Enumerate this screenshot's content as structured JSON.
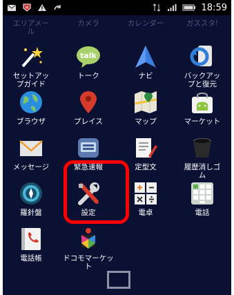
{
  "status_bar": {
    "time": "18:59",
    "left_icons": [
      "mail-icon",
      "shield-m-icon",
      "warning-icon",
      "sync-icon"
    ],
    "right_icons": [
      "data-arrows-icon",
      "signal-icon",
      "battery-icon"
    ]
  },
  "top_row": [
    {
      "label": "エリアメー\nル"
    },
    {
      "label": "カメラ"
    },
    {
      "label": "カレンダー"
    },
    {
      "label": "ガススタ!"
    }
  ],
  "apps": [
    {
      "label": "セットアッ\nプガイド",
      "icon": "setup-wand-icon"
    },
    {
      "label": "トーク",
      "icon": "talk-bubble-icon"
    },
    {
      "label": "ナビ",
      "icon": "navigation-arrow-icon"
    },
    {
      "label": "バックアッ\nプと復元",
      "icon": "backup-restore-icon"
    },
    {
      "label": "ブラウザ",
      "icon": "globe-icon"
    },
    {
      "label": "プレイス",
      "icon": "place-pin-icon"
    },
    {
      "label": "マップ",
      "icon": "map-icon"
    },
    {
      "label": "マーケット",
      "icon": "market-bag-icon"
    },
    {
      "label": "メッセージ",
      "icon": "envelope-icon"
    },
    {
      "label": "緊急速報",
      "icon": "emergency-alert-icon"
    },
    {
      "label": "定型文",
      "icon": "template-text-icon"
    },
    {
      "label": "履歴消しゴ\nム",
      "icon": "trash-icon"
    },
    {
      "label": "羅針盤",
      "icon": "compass-icon"
    },
    {
      "label": "設定",
      "icon": "settings-tools-icon"
    },
    {
      "label": "電卓",
      "icon": "calculator-icon"
    },
    {
      "label": "電話",
      "icon": "phone-keypad-icon"
    },
    {
      "label": "電話帳",
      "icon": "phonebook-icon"
    },
    {
      "label": "ドコモマーケット",
      "icon": "docomo-market-icon"
    }
  ],
  "colors": {
    "background": "#0b1133",
    "highlight": "#ff0000"
  }
}
